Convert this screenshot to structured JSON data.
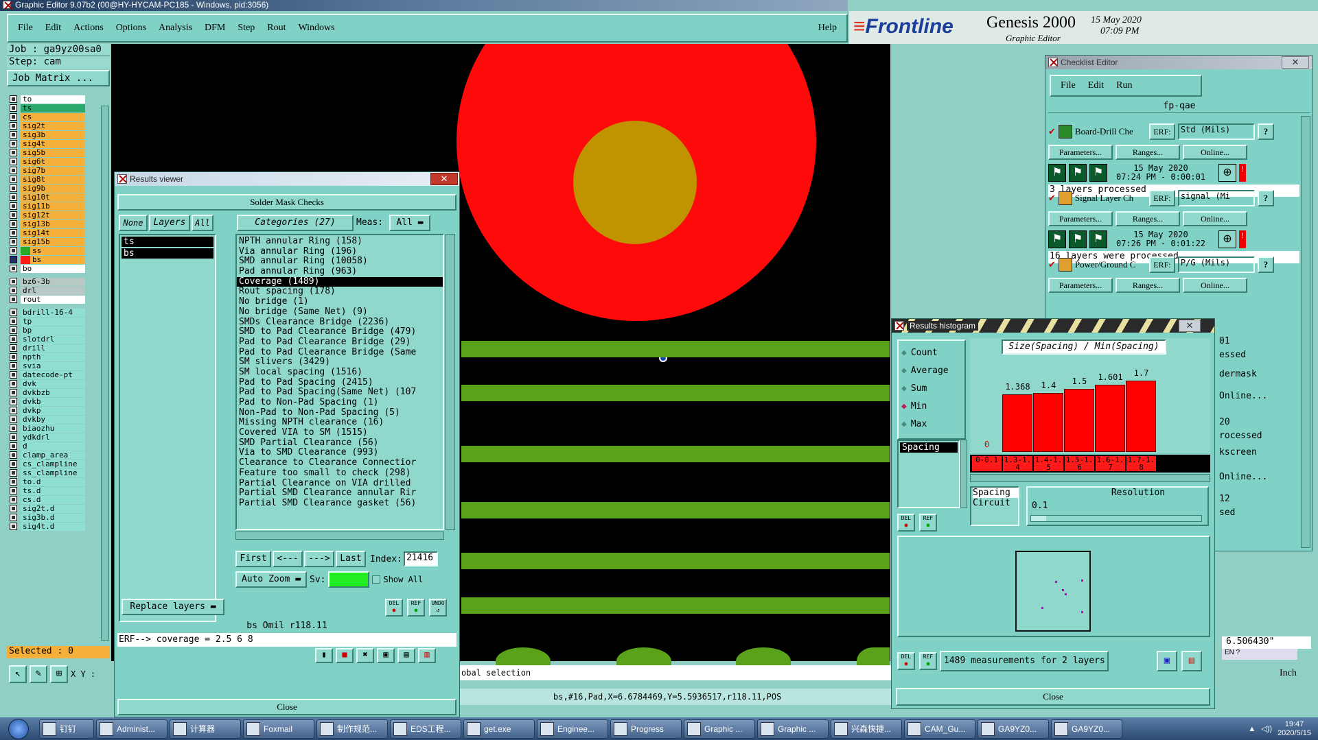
{
  "titlebar": {
    "text": "Graphic Editor 9.07b2 (00@HY-HYCAM-PC185 - Windows, pid:3056)"
  },
  "menu": {
    "items": [
      "File",
      "Edit",
      "Actions",
      "Options",
      "Analysis",
      "DFM",
      "Step",
      "Rout",
      "Windows"
    ],
    "help": "Help"
  },
  "brand": {
    "logo": "Frontline",
    "product": "Genesis 2000",
    "sub": "Graphic Editor",
    "date": "15 May 2020",
    "time": "07:09 PM"
  },
  "job": {
    "job_label": "Job : ga9yz00sa0",
    "step_label": "Step: cam",
    "matrix_button": "Job Matrix ..."
  },
  "layers": [
    {
      "name": "to",
      "color": "#ffffff"
    },
    {
      "name": "ts",
      "color": "#2aa86d"
    },
    {
      "name": "cs",
      "color": "#f4b03a"
    },
    {
      "name": "sig2t",
      "color": "#f4b03a"
    },
    {
      "name": "sig3b",
      "color": "#f4b03a"
    },
    {
      "name": "sig4t",
      "color": "#f4b03a"
    },
    {
      "name": "sig5b",
      "color": "#f4b03a"
    },
    {
      "name": "sig6t",
      "color": "#f4b03a"
    },
    {
      "name": "sig7b",
      "color": "#f4b03a"
    },
    {
      "name": "sig8t",
      "color": "#f4b03a"
    },
    {
      "name": "sig9b",
      "color": "#f4b03a"
    },
    {
      "name": "sig10t",
      "color": "#f4b03a"
    },
    {
      "name": "sig11b",
      "color": "#f4b03a"
    },
    {
      "name": "sig12t",
      "color": "#f4b03a"
    },
    {
      "name": "sig13b",
      "color": "#f4b03a"
    },
    {
      "name": "sig14t",
      "color": "#f4b03a"
    },
    {
      "name": "sig15b",
      "color": "#f4b03a"
    },
    {
      "name": "ss",
      "color": "#f4b03a"
    },
    {
      "name": "bs",
      "color": "#f4b03a"
    },
    {
      "name": "bo",
      "color": "#ffffff"
    },
    {
      "name": "bz6-3b",
      "color": "#b8c8c4"
    },
    {
      "name": "drl",
      "color": "#b8c8c4"
    },
    {
      "name": "rout",
      "color": "#ffffff"
    },
    {
      "name": "bdrill-16-4",
      "color": "#8fe0d2"
    },
    {
      "name": "tp",
      "color": "#8fe0d2"
    },
    {
      "name": "bp",
      "color": "#8fe0d2"
    },
    {
      "name": "slotdrl",
      "color": "#8fe0d2"
    },
    {
      "name": "drill",
      "color": "#8fe0d2"
    },
    {
      "name": "npth",
      "color": "#8fe0d2"
    },
    {
      "name": "svia",
      "color": "#8fe0d2"
    },
    {
      "name": "datecode-pt",
      "color": "#8fe0d2"
    },
    {
      "name": "dvk",
      "color": "#8fe0d2"
    },
    {
      "name": "dvkbzb",
      "color": "#8fe0d2"
    },
    {
      "name": "dvkb",
      "color": "#8fe0d2"
    },
    {
      "name": "dvkp",
      "color": "#8fe0d2"
    },
    {
      "name": "dvkby",
      "color": "#8fe0d2"
    },
    {
      "name": "biaozhu",
      "color": "#8fe0d2"
    },
    {
      "name": "ydkdrl",
      "color": "#8fe0d2"
    },
    {
      "name": "d",
      "color": "#8fe0d2"
    },
    {
      "name": "clamp_area",
      "color": "#8fe0d2"
    },
    {
      "name": "cs_clampline",
      "color": "#8fe0d2"
    },
    {
      "name": "ss_clampline",
      "color": "#8fe0d2"
    },
    {
      "name": "to.d",
      "color": "#8fe0d2"
    },
    {
      "name": "ts.d",
      "color": "#8fe0d2"
    },
    {
      "name": "cs.d",
      "color": "#8fe0d2"
    },
    {
      "name": "sig2t.d",
      "color": "#8fe0d2"
    },
    {
      "name": "sig3b.d",
      "color": "#8fe0d2"
    },
    {
      "name": "sig4t.d",
      "color": "#8fe0d2"
    }
  ],
  "selected_label": "Selected : 0",
  "bottom_left": {
    "xy_label": "X Y :"
  },
  "results_viewer": {
    "title": "Results viewer",
    "header": "Solder Mask Checks",
    "none_btn": "None",
    "layers_btn": "Layers",
    "all_btn": "All",
    "categories_btn": "Categories (27)",
    "meas_label": "Meas:",
    "meas_value": "All",
    "layer_list": [
      "ts",
      "bs"
    ],
    "categories": [
      "NPTH annular Ring (158)",
      "Via annular Ring (196)",
      "SMD annular Ring (10058)",
      "Pad annular Ring (963)",
      "Coverage (1489)",
      "Rout spacing (178)",
      "No bridge (1)",
      "No bridge (Same Net) (9)",
      "SMDs Clearance Bridge (2236)",
      "SMD to Pad Clearance Bridge (479)",
      "Pad to Pad Clearance Bridge (29)",
      "Pad to Pad Clearance Bridge (Same",
      "SM slivers (3429)",
      "SM local spacing (1516)",
      "Pad to Pad Spacing (2415)",
      "Pad to Pad Spacing(Same Net) (107",
      "Pad to Non-Pad Spacing (1)",
      "Non-Pad to Non-Pad Spacing (5)",
      "Missing NPTH clearance (16)",
      "Covered VIA to SM (1515)",
      "SMD Partial Clearance (56)",
      "Via to SMD Clearance (993)",
      "Clearance to Clearance Connectior",
      "Feature too small to check (298)",
      "Partial Clearance on VIA drilled",
      "Partial SMD Clearance annular Rir",
      "Partial SMD Clearance gasket (56)"
    ],
    "selected_category_index": 4,
    "first": "First",
    "prev": "<---",
    "next": "--->",
    "last": "Last",
    "index_label": "Index:",
    "index_value": "21416",
    "auto_zoom": "Auto Zoom",
    "sv_label": "Sv:",
    "show_all": "Show All",
    "replace_layers": "Replace layers",
    "layer_info": "bs Omil   r118.11",
    "erf_line": "ERF--> coverage = 2.5 6 8",
    "close": "Close",
    "del": "DEL",
    "ref": "REF",
    "undo": "UNDO"
  },
  "canvas": {
    "status_selection": "obal selection",
    "coords": "bs,#16,Pad,X=6.6784469,Y=5.5936517,r118.11,POS"
  },
  "checklist": {
    "title": "Checklist Editor",
    "menu": [
      "File",
      "Edit",
      "Run"
    ],
    "name": "fp-qae",
    "entries": [
      {
        "name": "Board-Drill Che",
        "erf": "ERF:",
        "erf_val": "Std (Mils)",
        "date": "15 May 2020",
        "time": "07:24 PM - 0:00:01",
        "status": "3 layers processed"
      },
      {
        "name": "Signal Layer Ch",
        "erf": "ERF:",
        "erf_val": "signal (Mi",
        "date": "15 May 2020",
        "time": "07:26 PM - 0:01:22",
        "status": "16 layers were processed"
      },
      {
        "name": "Power/Ground C",
        "erf": "ERF:",
        "erf_val": "P/G (Mils)",
        "date": "",
        "time": "",
        "status": ""
      }
    ],
    "params": "Parameters...",
    "ranges": "Ranges...",
    "online": "Online...",
    "partial": [
      "01",
      "essed",
      "dermask",
      "Online...",
      "20",
      "rocessed",
      "kscreen",
      "Online...",
      "12",
      "sed"
    ]
  },
  "histogram": {
    "title": "Results histogram",
    "options": [
      "Count",
      "Average",
      "Sum",
      "Min",
      "Max"
    ],
    "selected_option": "Min",
    "chart_title": "Size(Spacing) / Min(Spacing)",
    "type_list": [
      "Spacing"
    ],
    "spacing_circuit": [
      "Spacing",
      "Circuit"
    ],
    "resolution_label": "Resolution",
    "resolution_value": "0.1",
    "summary": "1489 measurements for 2 layers",
    "close": "Close",
    "del": "DEL",
    "ref": "REF"
  },
  "chart_data": {
    "type": "bar",
    "title": "Size(Spacing) / Min(Spacing)",
    "categories": [
      "0-0.1",
      "1.3-1.4",
      "1.4-1.5",
      "1.5-1.6",
      "1.6-1.7",
      "1.7-1.8"
    ],
    "values": [
      0,
      1.368,
      1.4,
      1.5,
      1.601,
      1.7
    ],
    "value_labels": [
      "0",
      "1.368",
      "1.4",
      "1.5",
      "1.601",
      "1.7"
    ]
  },
  "right_status": {
    "coord": "6.506430\"",
    "unit": "Inch"
  },
  "taskbar": {
    "items": [
      "钉钉",
      "Administ...",
      "计算器",
      "Foxmail",
      "制作规范...",
      "EDS工程...",
      "get.exe",
      "Enginee...",
      "Progress",
      "Graphic ...",
      "Graphic ...",
      "兴森快捷...",
      "CAM_Gu...",
      "GA9YZ0...",
      "GA9YZ0..."
    ],
    "time": "19:47",
    "date": "2020/5/15"
  }
}
